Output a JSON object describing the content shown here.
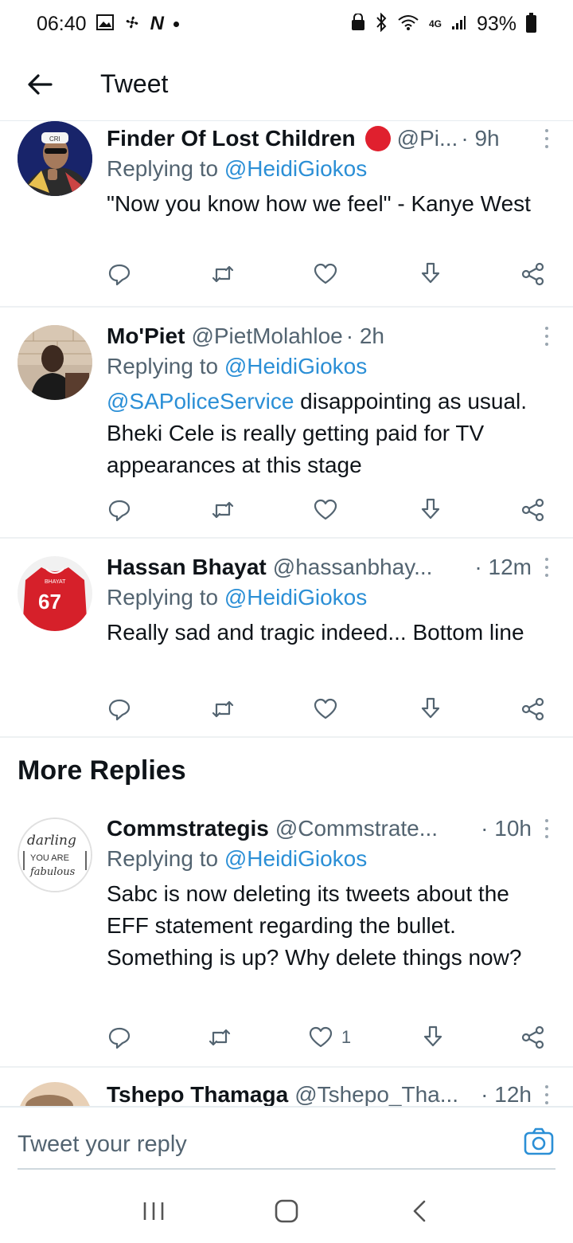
{
  "status_bar": {
    "time": "06:40",
    "battery": "93%",
    "network": "4G"
  },
  "header": {
    "title": "Tweet"
  },
  "tweets": [
    {
      "name": "Finder Of Lost Children",
      "handle": "@Pi...",
      "time": "· 9h",
      "replying_prefix": "Replying to ",
      "replying_to": "@HeidiGiokos",
      "text": "\"Now you know how we feel\" - Kanye West",
      "likes": "",
      "has_badge": true
    },
    {
      "name": "Mo'Piet",
      "handle": "@PietMolahloe",
      "time": "· 2h",
      "replying_prefix": "Replying to ",
      "replying_to": "@HeidiGiokos",
      "text_mention": "@SAPoliceService",
      "text": " disappointing as usual. Bheki Cele is really getting paid for TV appearances at this stage",
      "likes": ""
    },
    {
      "name": "Hassan Bhayat",
      "handle": "@hassanbhay...",
      "time": "· 12m",
      "replying_prefix": "Replying to ",
      "replying_to": "@HeidiGiokos",
      "text": "Really sad and tragic indeed... Bottom line",
      "likes": ""
    }
  ],
  "section": {
    "title": "More Replies"
  },
  "more_replies": [
    {
      "name": "Commstrategis",
      "handle": "@Commstrate...",
      "time": "· 10h",
      "replying_prefix": "Replying to ",
      "replying_to": "@HeidiGiokos",
      "text": "Sabc is now deleting its tweets about the EFF statement regarding the bullet. Something is up? Why delete things now?",
      "likes": "1",
      "avatar_text": [
        "darling",
        "YOU ARE",
        "fabulous"
      ]
    },
    {
      "name": "Tshepo Thamaga",
      "handle": "@Tshepo_Tha...",
      "time": "· 12h"
    }
  ],
  "reply_bar": {
    "placeholder": "Tweet your reply"
  },
  "avatar_texts": {
    "shirt_number": "67",
    "shirt_name": "BHAYAT",
    "cap_text": "CRI"
  },
  "colors": {
    "link": "#2b8fd6",
    "secondary_text": "#536471",
    "badge_red": "#e0202e"
  }
}
